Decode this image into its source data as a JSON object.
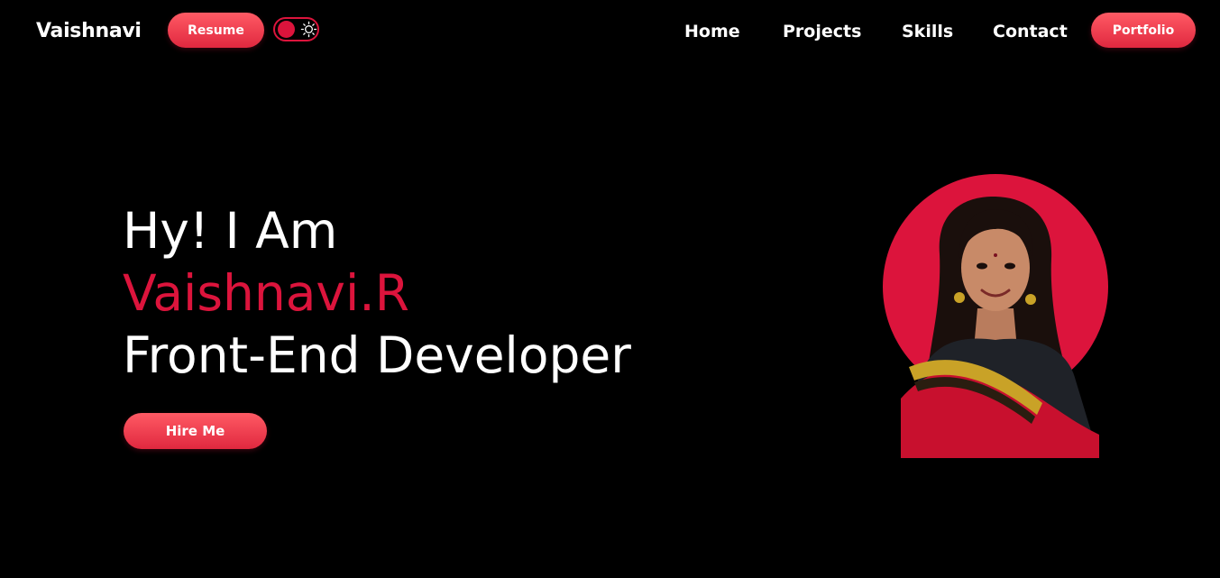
{
  "header": {
    "brand": "Vaishnavi",
    "resume_label": "Resume",
    "portfolio_label": "Portfolio",
    "nav": [
      {
        "label": "Home"
      },
      {
        "label": "Projects"
      },
      {
        "label": "Skills"
      },
      {
        "label": "Contact"
      }
    ],
    "theme_toggle": {
      "icon": "sun-icon",
      "state": "dark"
    }
  },
  "hero": {
    "greeting": "Hy! I Am",
    "name": "Vaishnavi.R",
    "role": "Front-End Developer",
    "hire_label": "Hire Me",
    "portrait_icon": "profile-photo"
  },
  "colors": {
    "accent": "#dc143c",
    "background": "#000000",
    "text": "#ffffff"
  }
}
